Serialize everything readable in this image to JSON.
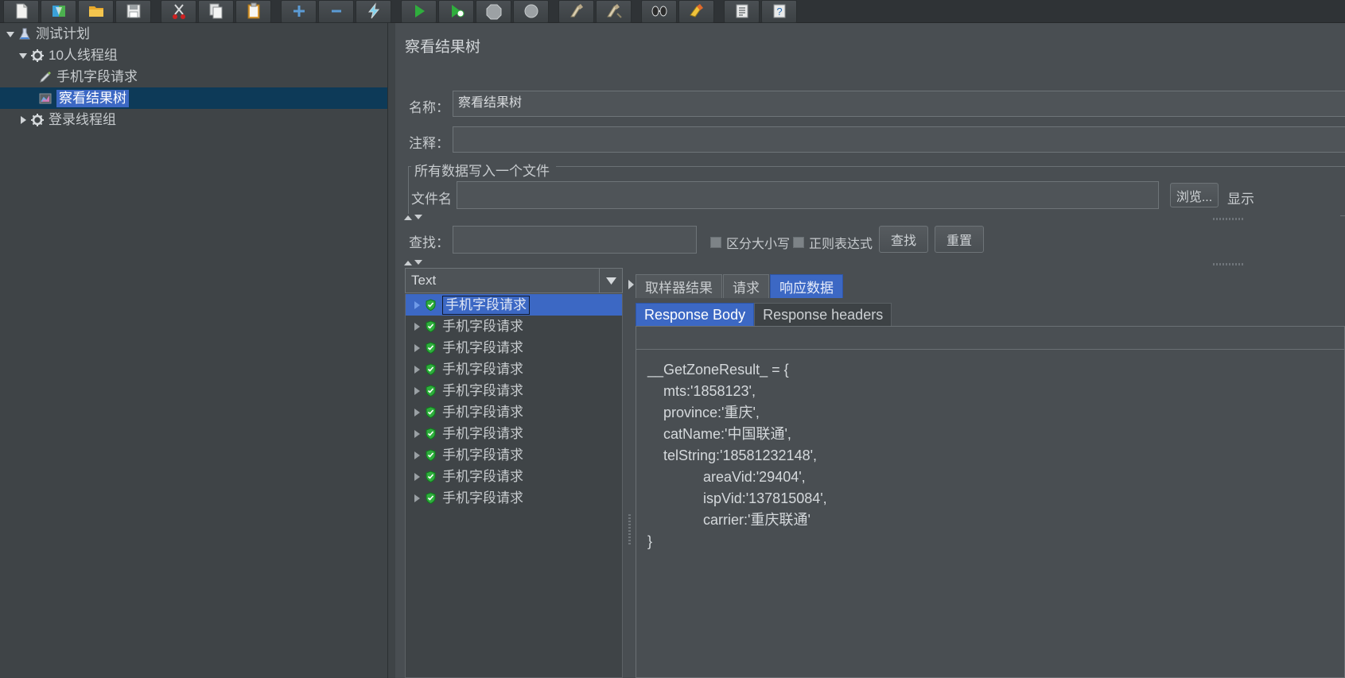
{
  "toolbar": {
    "buttons": [
      {
        "name": "new-icon",
        "title": "新建"
      },
      {
        "name": "templates-icon",
        "title": "模板"
      },
      {
        "name": "open-icon",
        "title": "打开"
      },
      {
        "name": "save-icon",
        "title": "保存"
      },
      {
        "name": "cut-icon",
        "title": "剪切"
      },
      {
        "name": "copy-icon",
        "title": "复制"
      },
      {
        "name": "paste-icon",
        "title": "粘贴"
      },
      {
        "name": "expand-all-icon",
        "title": "展开全部"
      },
      {
        "name": "collapse-all-icon",
        "title": "折叠全部"
      },
      {
        "name": "toggle-icon",
        "title": "启用/禁用"
      },
      {
        "name": "start-icon",
        "title": "启动"
      },
      {
        "name": "start-no-pauses-icon",
        "title": "无间隔启动"
      },
      {
        "name": "stop-icon",
        "title": "停止"
      },
      {
        "name": "shutdown-icon",
        "title": "关闭"
      },
      {
        "name": "clear-icon",
        "title": "清除"
      },
      {
        "name": "clear-all-icon",
        "title": "清除全部"
      },
      {
        "name": "search-icon",
        "title": "搜索"
      },
      {
        "name": "reset-search-icon",
        "title": "重置搜索"
      },
      {
        "name": "function-helper-icon",
        "title": "函数助手"
      },
      {
        "name": "help-icon",
        "title": "帮助"
      }
    ]
  },
  "tree": {
    "nodes": [
      {
        "label": "测试计划",
        "icon": "test-plan-icon",
        "depth": 1,
        "twisty": "down",
        "selected": false
      },
      {
        "label": "10人线程组",
        "icon": "thread-group-icon",
        "depth": 2,
        "twisty": "down",
        "selected": false
      },
      {
        "label": "手机字段请求",
        "icon": "http-sampler-icon",
        "depth": 3,
        "twisty": "none",
        "selected": false
      },
      {
        "label": "察看结果树",
        "icon": "view-results-tree-icon",
        "depth": 3,
        "twisty": "none",
        "selected": true
      },
      {
        "label": "登录线程组",
        "icon": "thread-group-icon",
        "depth": 2,
        "twisty": "right",
        "selected": false
      }
    ]
  },
  "main": {
    "title": "察看结果树",
    "name_label": "名称：",
    "name_value": "察看结果树",
    "comment_label": "注释：",
    "comment_value": "",
    "filegroup": {
      "title": "所有数据写入一个文件",
      "file_label": "文件名",
      "file_value": "",
      "browse_label": "浏览...",
      "show_label": "显示"
    },
    "search": {
      "find_label": "查找：",
      "find_value": "",
      "case_label": "区分大小写",
      "case_checked": false,
      "regex_label": "正则表达式",
      "regex_checked": false,
      "find_button": "查找",
      "reset_button": "重置"
    },
    "results": {
      "renderer_selected": "Text",
      "items": [
        {
          "label": "手机字段请求",
          "status": "success",
          "selected": true
        },
        {
          "label": "手机字段请求",
          "status": "success",
          "selected": false
        },
        {
          "label": "手机字段请求",
          "status": "success",
          "selected": false
        },
        {
          "label": "手机字段请求",
          "status": "success",
          "selected": false
        },
        {
          "label": "手机字段请求",
          "status": "success",
          "selected": false
        },
        {
          "label": "手机字段请求",
          "status": "success",
          "selected": false
        },
        {
          "label": "手机字段请求",
          "status": "success",
          "selected": false
        },
        {
          "label": "手机字段请求",
          "status": "success",
          "selected": false
        },
        {
          "label": "手机字段请求",
          "status": "success",
          "selected": false
        },
        {
          "label": "手机字段请求",
          "status": "success",
          "selected": false
        }
      ],
      "tabs": [
        {
          "label": "取样器结果",
          "active": false
        },
        {
          "label": "请求",
          "active": false
        },
        {
          "label": "响应数据",
          "active": true
        }
      ],
      "inner_tabs": [
        {
          "label": "Response Body",
          "active": true
        },
        {
          "label": "Response headers",
          "active": false
        }
      ],
      "response_body": "__GetZoneResult_ = {\n    mts:'1858123',\n    province:'重庆',\n    catName:'中国联通',\n    telString:'18581232148',\n              areaVid:'29404',\n              ispVid:'137815084',\n              carrier:'重庆联通'\n}",
      "response_search_value": ""
    }
  },
  "colors": {
    "accent": "#3c68c4",
    "tree_selection": "#0d3a58",
    "panel_bg": "#494e52",
    "window_bg": "#3f4447",
    "toolbar_bg": "#2f3336",
    "success_green": "#2fae3d"
  }
}
